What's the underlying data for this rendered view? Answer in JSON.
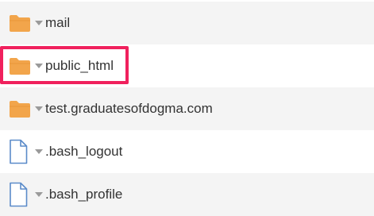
{
  "files": [
    {
      "name": "mail",
      "type": "folder",
      "icon": "folder-icon"
    },
    {
      "name": "public_html",
      "type": "folder",
      "icon": "folder-icon"
    },
    {
      "name": "test.graduatesofdogma.com",
      "type": "folder",
      "icon": "folder-icon"
    },
    {
      "name": ".bash_logout",
      "type": "file",
      "icon": "file-icon"
    },
    {
      "name": ".bash_profile",
      "type": "file",
      "icon": "file-icon"
    }
  ],
  "colors": {
    "folder": "#f2a54b",
    "file_stroke": "#5b8bc9",
    "highlight": "#f0215d",
    "row_alt": "#f4f4f4",
    "text": "#333333"
  }
}
